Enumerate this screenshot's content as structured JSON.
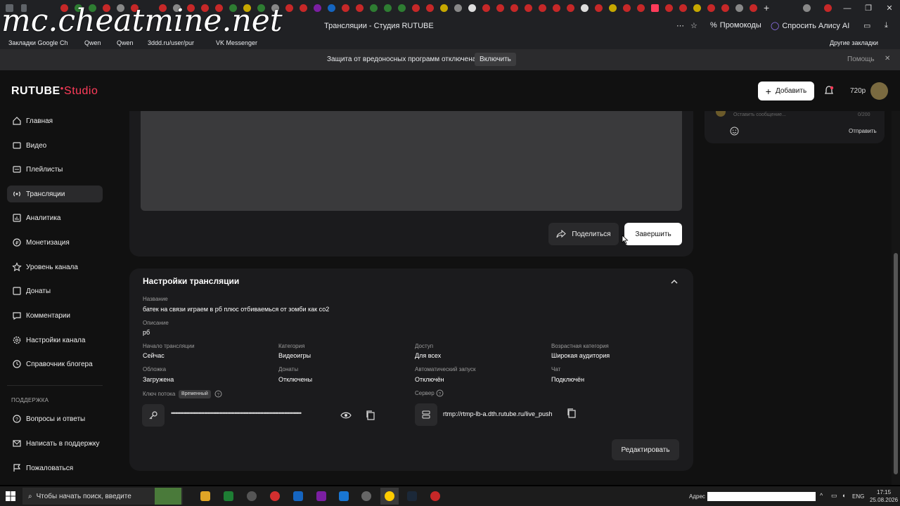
{
  "browser": {
    "tab_title": "Трансляции - Студия RUTUBE",
    "watermark": "mc.cheatmine.net",
    "promo_label": "Промокоды",
    "alice_label": "Спросить Алису AI",
    "bookmarks": [
      "Закладки Google Ch",
      "Qwen",
      "Qwen",
      "3ddd.ru/user/pur",
      "VK Messenger"
    ],
    "other_bookmarks": "Другие закладки",
    "infobar_text": "Защита от вредоносных программ отключена",
    "infobar_button": "Включить",
    "help_label": "Помощь"
  },
  "header": {
    "logo_main": "RUTUBE",
    "logo_studio": "Studio",
    "add_button": "Добавить",
    "quality": "720p"
  },
  "sidebar": {
    "items": [
      {
        "label": "Главная",
        "icon": "home-icon"
      },
      {
        "label": "Видео",
        "icon": "video-icon"
      },
      {
        "label": "Плейлисты",
        "icon": "playlist-icon"
      },
      {
        "label": "Трансляции",
        "icon": "broadcast-icon",
        "active": true
      },
      {
        "label": "Аналитика",
        "icon": "analytics-icon"
      },
      {
        "label": "Монетизация",
        "icon": "monetization-icon"
      },
      {
        "label": "Уровень канала",
        "icon": "star-icon"
      },
      {
        "label": "Донаты",
        "icon": "donate-icon"
      },
      {
        "label": "Комментарии",
        "icon": "comment-icon"
      },
      {
        "label": "Настройки канала",
        "icon": "gear-icon"
      },
      {
        "label": "Справочник блогера",
        "icon": "book-icon"
      }
    ],
    "support_heading": "ПОДДЕРЖКА",
    "support_items": [
      {
        "label": "Вопросы и ответы",
        "icon": "help-icon"
      },
      {
        "label": "Написать в поддержку",
        "icon": "mail-icon"
      },
      {
        "label": "Пожаловаться",
        "icon": "flag-icon"
      }
    ]
  },
  "player": {
    "share_button": "Поделиться",
    "finish_button": "Завершить"
  },
  "settings": {
    "title": "Настройки трансляции",
    "name_label": "Название",
    "name_value": "батек на связи играем в рб плюс отбиваемься от зомби как со2",
    "desc_label": "Описание",
    "desc_value": "рб",
    "fields": [
      {
        "label": "Начало трансляции",
        "value": "Сейчас"
      },
      {
        "label": "Категория",
        "value": "Видеоигры"
      },
      {
        "label": "Доступ",
        "value": "Для всех"
      },
      {
        "label": "Возрастная категория",
        "value": "Широкая аудитория"
      },
      {
        "label": "Обложка",
        "value": "Загружена"
      },
      {
        "label": "Донаты",
        "value": "Отключены"
      },
      {
        "label": "Автоматический запуск",
        "value": "Отключён"
      },
      {
        "label": "Чат",
        "value": "Подключён"
      }
    ],
    "stream_key_label": "Ключ потока",
    "stream_key_badge": "Временный",
    "stream_key_masked": "••••••••••••••••••••••••••••••••••••••••••••••••••••••••••••••••••••••••••••••••••••••",
    "server_label": "Сервер",
    "server_url": "rtmp://rtmp-lb-a.dth.rutube.ru/live_push",
    "edit_button": "Редактировать"
  },
  "chat": {
    "placeholder": "Оставить сообщение...",
    "counter": "0/200",
    "send_button": "Отправить"
  },
  "taskbar": {
    "search_placeholder": "Чтобы начать поиск, введите",
    "address_label": "Адрес",
    "lang": "ENG",
    "time": "17:15",
    "date": "25.08.2026"
  },
  "colors": {
    "brand_accent": "#ff3c5a",
    "background": "#111111",
    "card": "#1b1b1d"
  }
}
